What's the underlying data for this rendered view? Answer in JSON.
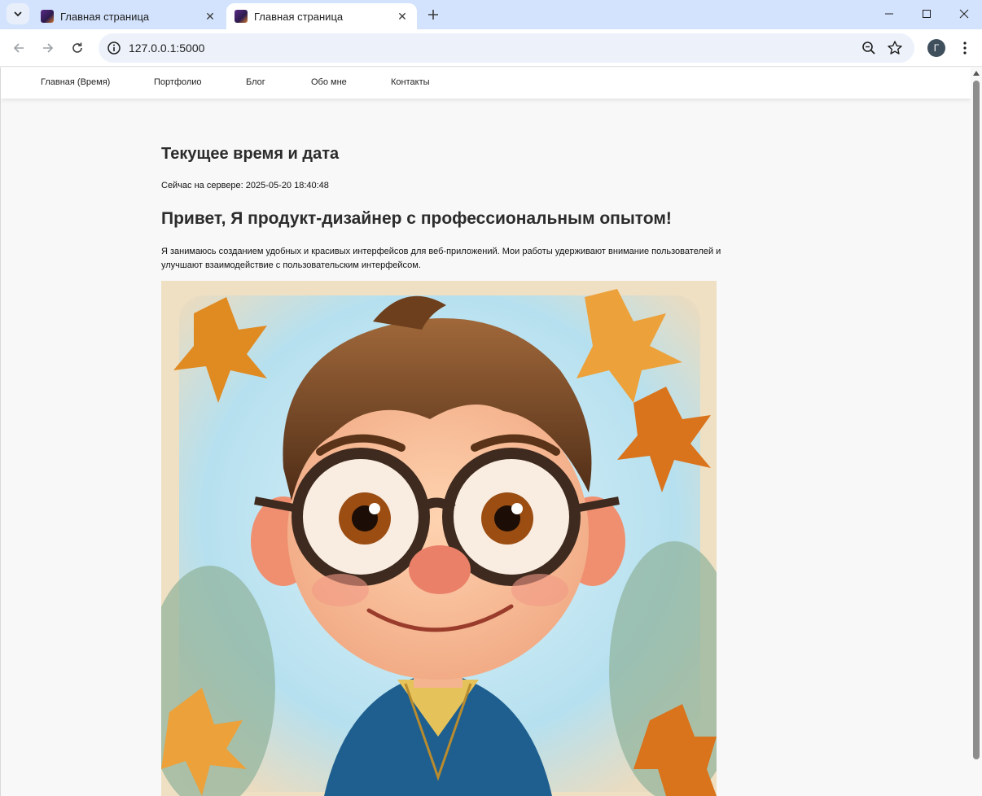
{
  "browser": {
    "tabs": [
      {
        "title": "Главная страница",
        "active": false
      },
      {
        "title": "Главная страница",
        "active": true
      }
    ],
    "url": "127.0.0.1:5000",
    "profile_initial": "Г"
  },
  "nav": {
    "items": [
      "Главная (Время)",
      "Портфолио",
      "Блог",
      "Обо мне",
      "Контакты"
    ]
  },
  "main": {
    "time_title": "Текущее время и дата",
    "server_time": "Сейчас на сервере: 2025-05-20 18:40:48",
    "hero_title": "Привет, Я продукт-дизайнер с профессиональным опытом!",
    "hero_text": "Я занимаюсь созданием удобных и красивых интерфейсов для веб-приложений. Мои работы удерживают внимание пользователей и улучшают взаимодействие с пользовательским интерфейсом."
  },
  "colors": {
    "tabstrip": "#d3e3fd",
    "omnibox": "#edf2fa",
    "page_bg": "#f8f8f8",
    "heading": "#2b2b2b"
  }
}
